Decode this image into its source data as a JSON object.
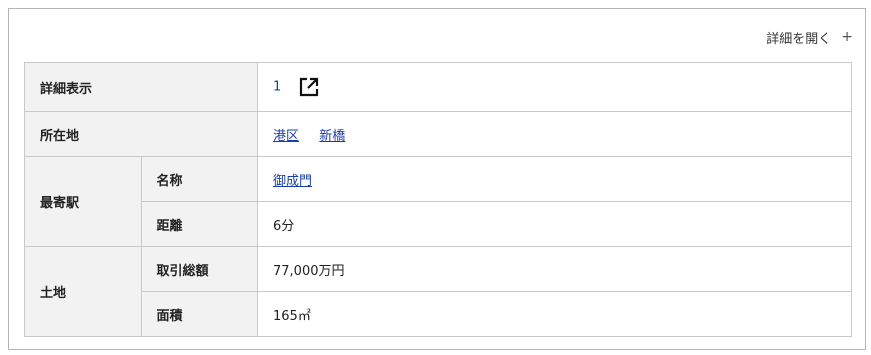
{
  "toggle": {
    "label": "詳細を開く",
    "icon": "plus-icon"
  },
  "rows": {
    "detail": {
      "label": "詳細表示",
      "value": "1",
      "icon": "external-link-icon"
    },
    "location": {
      "label": "所在地",
      "links": [
        "港区",
        "新橋"
      ]
    },
    "station": {
      "label": "最寄駅",
      "name_label": "名称",
      "name_value": "御成門",
      "distance_label": "距離",
      "distance_value": "6分"
    },
    "land": {
      "label": "土地",
      "total_label": "取引総額",
      "total_value": "77,000万円",
      "area_label": "面積",
      "area_value": "165㎡"
    }
  }
}
